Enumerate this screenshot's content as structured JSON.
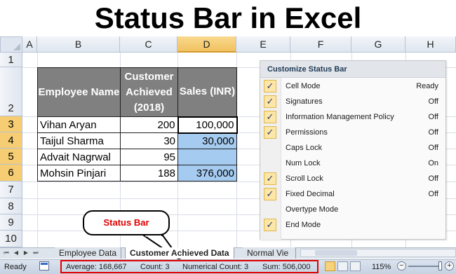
{
  "page": {
    "title": "Status Bar in Excel"
  },
  "columns": [
    "A",
    "B",
    "C",
    "D",
    "E",
    "F",
    "G",
    "H"
  ],
  "selected_column": "D",
  "rows": [
    "1",
    "2",
    "3",
    "4",
    "5",
    "6",
    "7",
    "8",
    "9",
    "10"
  ],
  "selected_rows": [
    "3",
    "4",
    "5",
    "6"
  ],
  "table": {
    "headers": [
      "Employee Name",
      "Customer Achieved (2018)",
      "Sales (INR)"
    ],
    "rows": [
      {
        "name": "Vihan Aryan",
        "customers": "200",
        "sales": "100,000"
      },
      {
        "name": "Taijul Sharma",
        "customers": "30",
        "sales": "30,000"
      },
      {
        "name": "Advait Nagrwal",
        "customers": "95",
        "sales": ""
      },
      {
        "name": "Mohsin Pinjari",
        "customers": "188",
        "sales": "376,000"
      }
    ]
  },
  "customize_menu": {
    "title": "Customize Status Bar",
    "items": [
      {
        "label": "Cell Mode",
        "value": "Ready",
        "checked": true
      },
      {
        "label": "Signatures",
        "value": "Off",
        "checked": true
      },
      {
        "label": "Information Management Policy",
        "value": "Off",
        "checked": true
      },
      {
        "label": "Permissions",
        "value": "Off",
        "checked": true
      },
      {
        "label": "Caps Lock",
        "value": "Off",
        "checked": false
      },
      {
        "label": "Num Lock",
        "value": "On",
        "checked": false
      },
      {
        "label": "Scroll Lock",
        "value": "Off",
        "checked": true
      },
      {
        "label": "Fixed Decimal",
        "value": "Off",
        "checked": true
      },
      {
        "label": "Overtype Mode",
        "value": "",
        "checked": false
      },
      {
        "label": "End Mode",
        "value": "",
        "checked": true
      }
    ],
    "check_glyph": "✓"
  },
  "callout": {
    "text": "Status Bar"
  },
  "sheet_tabs": {
    "tabs": [
      "Employee Data",
      "Customer Achieved Data",
      "Normal Vie"
    ],
    "active_index": 1
  },
  "status_bar": {
    "mode": "Ready",
    "average": "Average:  168,667",
    "count": "Count: 3",
    "numerical_count": "Numerical Count: 3",
    "sum": "Sum:  506,000",
    "zoom": "115%"
  },
  "colors": {
    "highlight_red": "#e00000",
    "header_gray": "#808080",
    "selected_blue": "#a6cbf0",
    "check_bg": "#fde7a8"
  }
}
